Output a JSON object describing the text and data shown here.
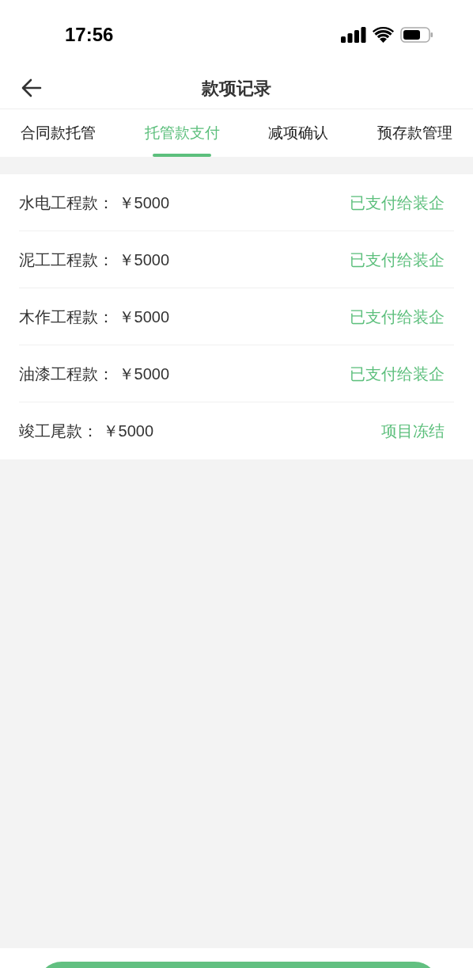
{
  "status_bar": {
    "time": "17:56"
  },
  "header": {
    "title": "款项记录"
  },
  "tabs": [
    {
      "label": "合同款托管",
      "selected": false
    },
    {
      "label": "托管款支付",
      "selected": true
    },
    {
      "label": "减项确认",
      "selected": false
    },
    {
      "label": "预存款管理",
      "selected": false
    }
  ],
  "records": [
    {
      "name": "水电工程款：",
      "amount": "￥5000",
      "status": "已支付给装企"
    },
    {
      "name": "泥工工程款：",
      "amount": "￥5000",
      "status": "已支付给装企"
    },
    {
      "name": "木作工程款：",
      "amount": "￥5000",
      "status": "已支付给装企"
    },
    {
      "name": "油漆工程款：",
      "amount": "￥5000",
      "status": "已支付给装企"
    },
    {
      "name": "竣工尾款：",
      "amount": "￥5000",
      "status": "项目冻结"
    }
  ]
}
